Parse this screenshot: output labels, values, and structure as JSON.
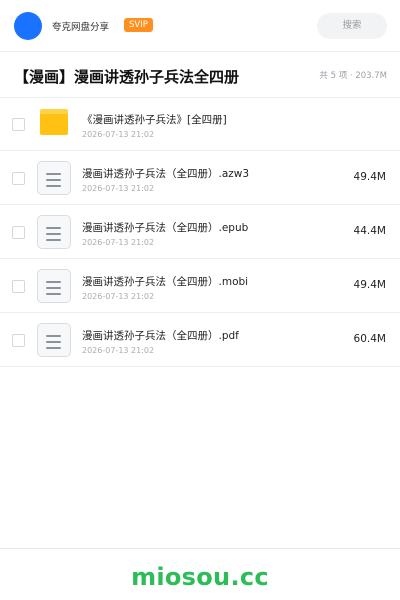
{
  "header": {
    "username": "夸克网盘分享",
    "badge": "SVIP",
    "search_placeholder": "搜索"
  },
  "share": {
    "title": "【漫画】漫画讲透孙子兵法全四册",
    "summary": "共 5 项 · 203.7M"
  },
  "files": [
    {
      "type": "folder",
      "icon": "folder-icon",
      "name": "《漫画讲透孙子兵法》[全四册]",
      "date": "2026-07-13 21:02",
      "size": ""
    },
    {
      "type": "file",
      "icon": "document-icon",
      "name": "漫画讲透孙子兵法（全四册）.azw3",
      "date": "2026-07-13 21:02",
      "size": "49.4M"
    },
    {
      "type": "file",
      "icon": "document-icon",
      "name": "漫画讲透孙子兵法（全四册）.epub",
      "date": "2026-07-13 21:02",
      "size": "44.4M"
    },
    {
      "type": "file",
      "icon": "document-icon",
      "name": "漫画讲透孙子兵法（全四册）.mobi",
      "date": "2026-07-13 21:02",
      "size": "49.4M"
    },
    {
      "type": "file",
      "icon": "document-icon",
      "name": "漫画讲透孙子兵法（全四册）.pdf",
      "date": "2026-07-13 21:02",
      "size": "60.4M"
    }
  ],
  "footer": {
    "watermark": "miosou.cc"
  },
  "colors": {
    "avatar": "#1a73ff",
    "badge": "#ff8f1f",
    "folder": "#ffc212",
    "watermark": "#2dbd58"
  }
}
